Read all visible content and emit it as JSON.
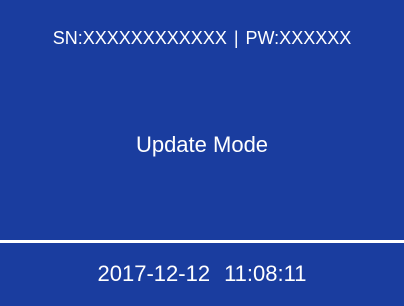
{
  "header": {
    "serial": "SN:XXXXXXXXXXXX",
    "separator": "|",
    "password": "PW:XXXXXX"
  },
  "main": {
    "mode": "Update Mode"
  },
  "footer": {
    "date": "2017-12-12",
    "time": "11:08:11"
  },
  "colors": {
    "panel_bg": "#1a3d9f",
    "text": "#ffffff",
    "divider": "#ffffff"
  }
}
